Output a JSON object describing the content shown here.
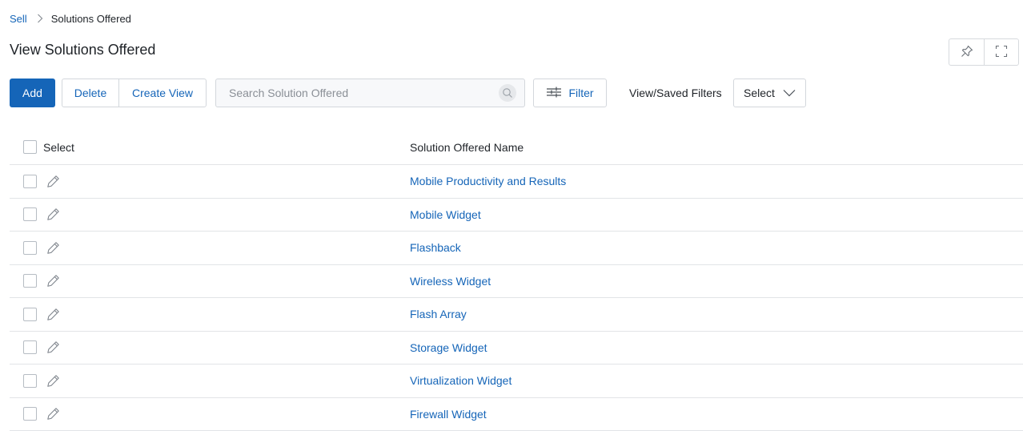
{
  "breadcrumb": {
    "root": "Sell",
    "current": "Solutions Offered"
  },
  "page": {
    "title": "View Solutions Offered"
  },
  "header_actions": {
    "pin_icon": "pin-icon",
    "expand_icon": "fullscreen-icon"
  },
  "toolbar": {
    "add_label": "Add",
    "delete_label": "Delete",
    "create_view_label": "Create View",
    "search_placeholder": "Search Solution Offered",
    "search_value": "",
    "filter_label": "Filter",
    "saved_filters_label": "View/Saved Filters",
    "saved_filters_value": "Select"
  },
  "table": {
    "columns": [
      "Select",
      "Solution Offered Name"
    ],
    "rows": [
      {
        "name": "Mobile Productivity and Results"
      },
      {
        "name": "Mobile Widget"
      },
      {
        "name": "Flashback"
      },
      {
        "name": "Wireless Widget"
      },
      {
        "name": "Flash Array"
      },
      {
        "name": "Storage Widget"
      },
      {
        "name": "Virtualization Widget"
      },
      {
        "name": "Firewall Widget"
      }
    ]
  },
  "colors": {
    "accent": "#1565b8",
    "border": "#d3d7dc",
    "text": "#1f2328"
  }
}
